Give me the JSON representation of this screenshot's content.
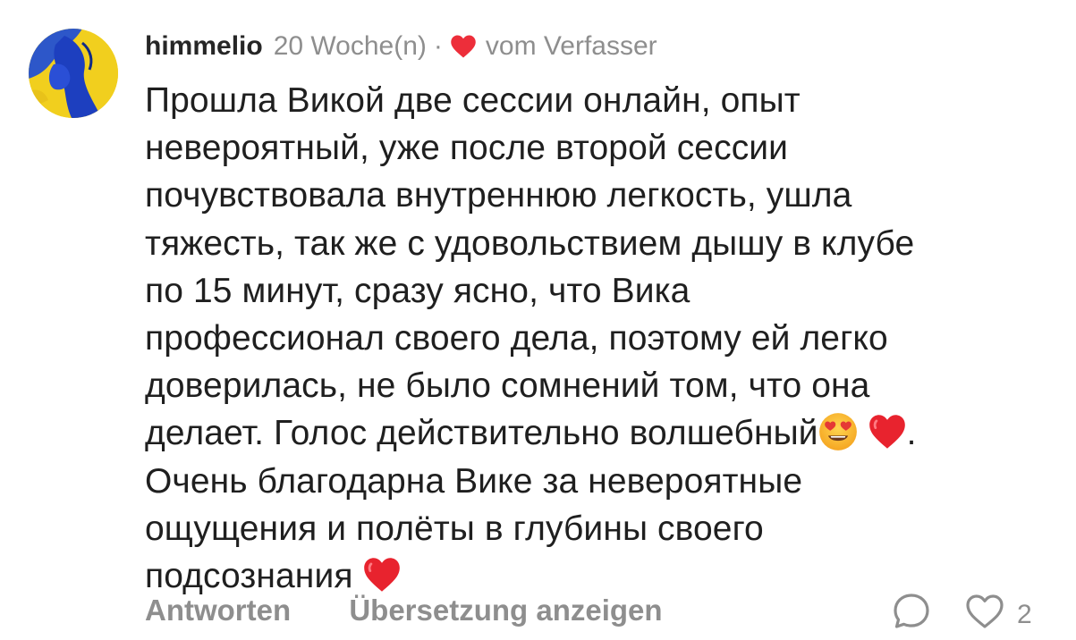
{
  "comment": {
    "username": "himmelio",
    "timestamp": "20 Woche(n)",
    "separator": "·",
    "by_author": "vom Verfasser",
    "text_part1": "Прошла Викой две сессии онлайн,  опыт\nневероятный, уже после второй сессии\nпочувствовала внутреннюю легкость, ушла\nтяжесть,  так же с удовольствием дышу в клубе\nпо 15 минут, сразу ясно, что Вика\nпрофессионал своего дела, поэтому ей легко\nдоверилась, не было сомнений том, что она\nделает. Голос действительно волшебный",
    "text_part2": ".\nОчень благодарна Вике за невероятные\nощущения и полёты в глубины своего\nподсознания ",
    "emojis": [
      "smiling-face-with-heart-eyes",
      "red-heart",
      "red-heart"
    ],
    "actions": {
      "reply": "Antworten",
      "translate": "Übersetzung anzeigen"
    },
    "like_count": "2",
    "colors": {
      "text": "#262626",
      "muted": "#8e8e8e",
      "heart": "#ed2e3a"
    }
  }
}
